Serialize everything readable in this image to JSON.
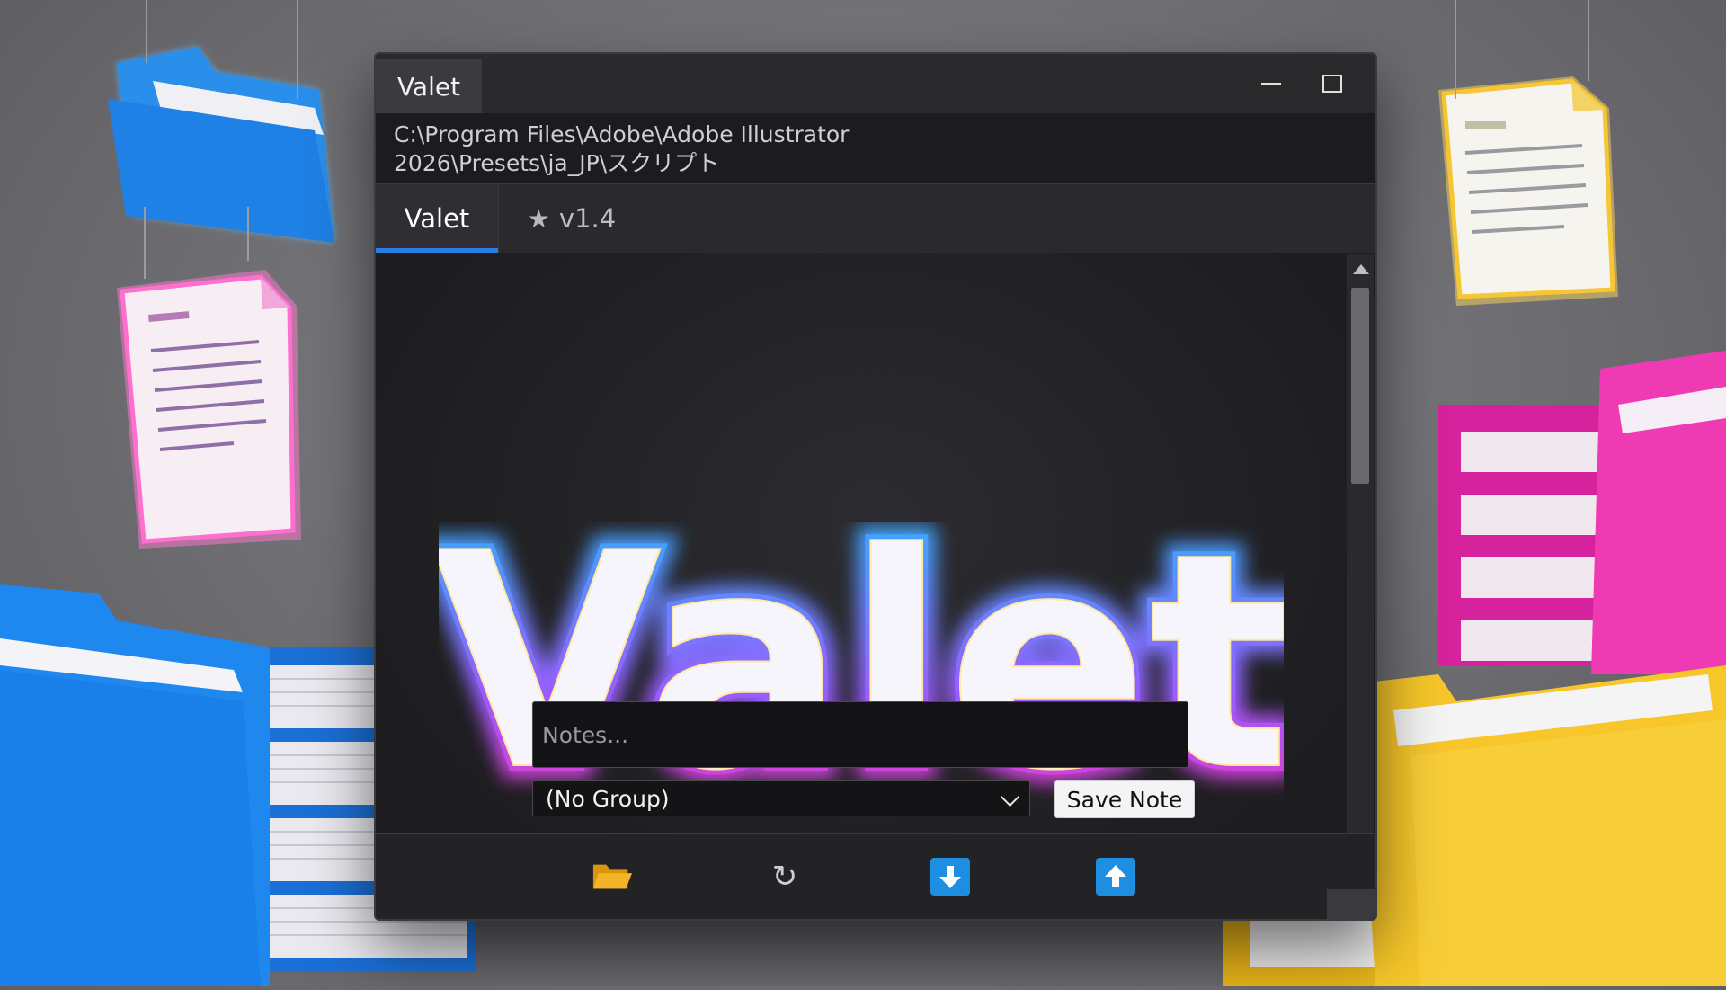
{
  "window": {
    "title": "Valet",
    "path": "C:\\Program Files\\Adobe\\Adobe Illustrator 2026\\Presets\\ja_JP\\スクリプト"
  },
  "tabs": [
    {
      "label": "Valet",
      "active": true
    },
    {
      "label": "v1.4",
      "icon": "star-icon",
      "active": false
    }
  ],
  "logo": {
    "text": "Valet"
  },
  "notes": {
    "placeholder": "Notes..."
  },
  "group_select": {
    "selected": "(No Group)"
  },
  "save_button": {
    "label": "Save Note"
  },
  "toolbar": {
    "icons": [
      "folder-open-icon",
      "refresh-icon",
      "download-arrow-icon",
      "upload-arrow-icon"
    ]
  },
  "colors": {
    "accent": "#2a7de0",
    "arrow_button": "#1e8fe0",
    "folder_icon": "#f3b428",
    "logo_glow_cyan": "#29b6ff",
    "logo_glow_magenta": "#ff2fc0"
  }
}
